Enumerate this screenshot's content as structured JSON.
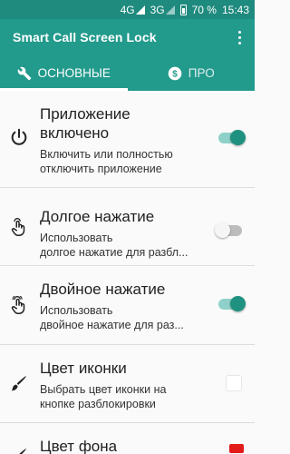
{
  "status_bar": {
    "network1": "4G",
    "network2": "3G",
    "battery": "70 %",
    "time": "15:43"
  },
  "app_bar": {
    "title": "Smart Call Screen Lock"
  },
  "tabs": [
    {
      "label": "ОСНОВНЫЕ",
      "active": true,
      "icon": "wrench-icon"
    },
    {
      "label": "ПРО",
      "active": false,
      "icon": "dollar-circle-icon"
    }
  ],
  "settings": [
    {
      "title_line1": "Приложение",
      "title_line2": "включено",
      "subtitle_line1": "Включить или полностью",
      "subtitle_line2": "отключить приложение",
      "toggle": "on",
      "icon": "power-icon"
    },
    {
      "title_line1": "Долгое нажатие",
      "subtitle_line1": "Использовать",
      "subtitle_line2": "долгое нажатие для разбл...",
      "toggle": "off",
      "icon": "long-press-hand-icon"
    },
    {
      "title_line1": "Двойное нажатие",
      "subtitle_line1": "Использовать",
      "subtitle_line2": "двойное нажатие для раз...",
      "toggle": "on",
      "icon": "double-tap-hand-icon"
    },
    {
      "title_line1": "Цвет иконки",
      "subtitle_line1": "Выбрать цвет иконки на",
      "subtitle_line2": "кнопке разблокировки",
      "icon": "brush-icon",
      "swatch_color": "#ffffff"
    },
    {
      "title_line1": "Цвет фона",
      "icon": "brush-icon",
      "swatch_color": "#e21b1b"
    }
  ],
  "colors": {
    "status_bar": "#1f8a7e",
    "app_bar": "#229a8c",
    "accent": "#1f9180"
  }
}
